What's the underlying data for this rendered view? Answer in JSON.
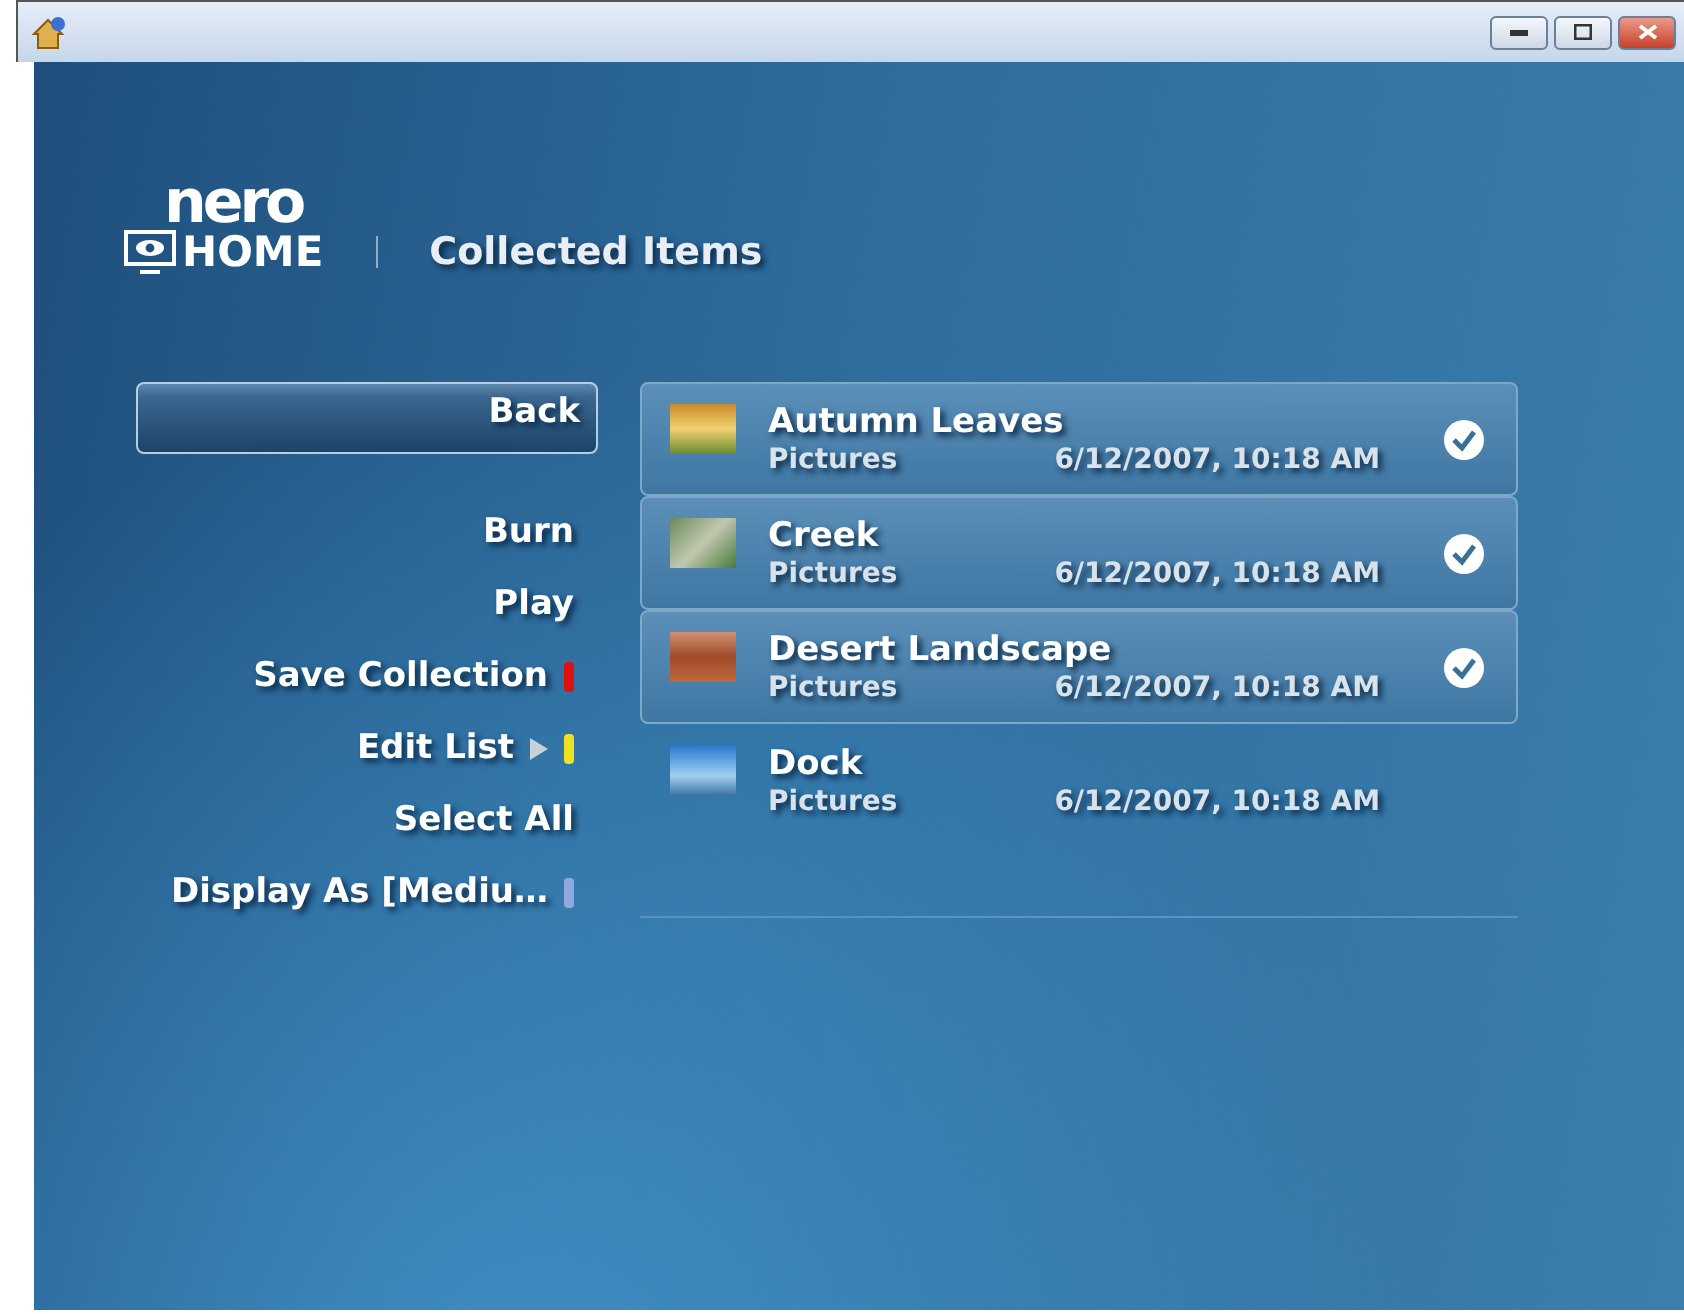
{
  "logo": {
    "top": "nero",
    "bottom": "HOME"
  },
  "page_title": "Collected Items",
  "menu": [
    {
      "label": "Back",
      "selected": true,
      "submenu": false
    },
    {
      "label": "Burn",
      "selected": false,
      "submenu": false
    },
    {
      "label": "Play",
      "selected": false,
      "submenu": false
    },
    {
      "label": "Save Collection",
      "selected": false,
      "submenu": false,
      "color": "#e01010"
    },
    {
      "label": "Edit List",
      "selected": false,
      "submenu": true,
      "color": "#f0e020"
    },
    {
      "label": "Select All",
      "selected": false,
      "submenu": false
    },
    {
      "label": "Display As [Mediu…",
      "selected": false,
      "submenu": false,
      "color": "#8fa8e0"
    }
  ],
  "items": [
    {
      "name": "Autumn Leaves",
      "type": "Pictures",
      "date": "6/12/2007, 10:18 AM",
      "checked": true
    },
    {
      "name": "Creek",
      "type": "Pictures",
      "date": "6/12/2007, 10:18 AM",
      "checked": true
    },
    {
      "name": "Desert Landscape",
      "type": "Pictures",
      "date": "6/12/2007, 10:18 AM",
      "checked": true
    },
    {
      "name": "Dock",
      "type": "Pictures",
      "date": "6/12/2007, 10:18 AM",
      "checked": false
    }
  ]
}
